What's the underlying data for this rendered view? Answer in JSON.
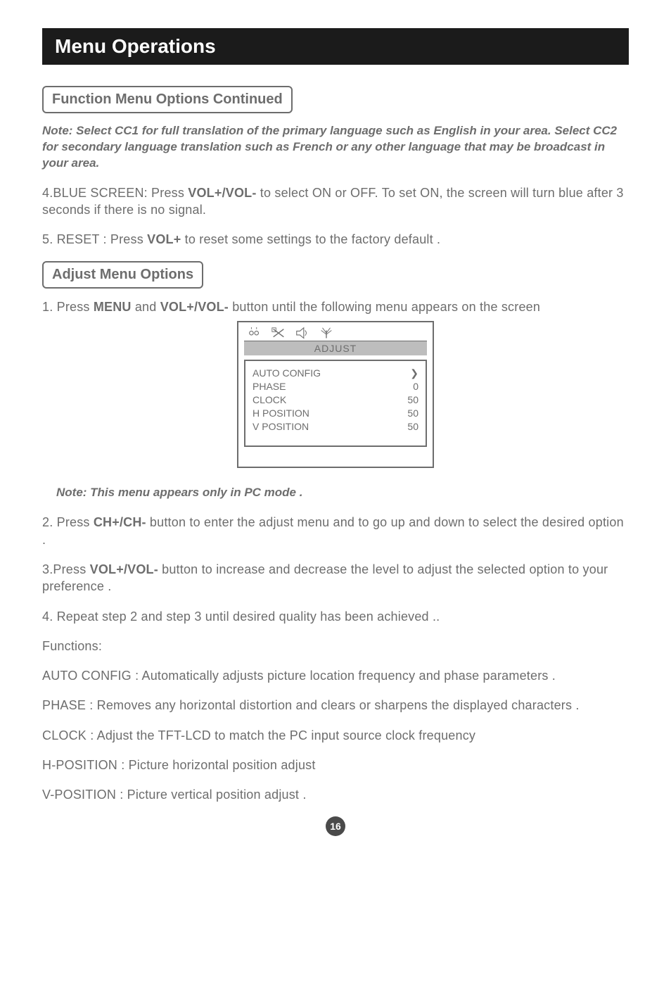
{
  "banner": "Menu Operations",
  "section1_title": "Function Menu Options Continued",
  "note1": "Note: Select CC1 for full translation of the primary language such as English in your area. Select CC2 for secondary language translation such as French  or any other language that may be broadcast in your area.",
  "p_blue_pre": "4.BLUE SCREEN: Press ",
  "p_blue_bold": "VOL+/VOL-",
  "p_blue_post": " to select ON or OFF.  To set ON, the screen will turn blue after 3 seconds if there is no signal.",
  "p_reset_pre": "5. RESET : Press ",
  "p_reset_bold": "VOL+",
  "p_reset_post": " to reset some settings to the factory default .",
  "section2_title": "Adjust  Menu Options",
  "p_step1_pre": "1. Press ",
  "p_step1_b1": "MENU",
  "p_step1_mid": " and ",
  "p_step1_b2": "VOL+/VOL-",
  "p_step1_post": " button until the following menu appears on the screen",
  "menu": {
    "title": "ADJUST",
    "rows": [
      {
        "label": "AUTO CONFIG",
        "value": "❯"
      },
      {
        "label": "PHASE",
        "value": "0"
      },
      {
        "label": "CLOCK",
        "value": "50"
      },
      {
        "label": "H POSITION",
        "value": "50"
      },
      {
        "label": "V POSITION",
        "value": "50"
      }
    ]
  },
  "note2": "Note: This menu appears only in PC mode .",
  "p_step2_pre": "2. Press ",
  "p_step2_bold": "CH+/CH-",
  "p_step2_post": " button to enter the adjust menu and to go up and down to select the desired option .",
  "p_step3_pre": "3.Press ",
  "p_step3_bold": "VOL+/VOL-",
  "p_step3_post": " button to increase and decrease the level to adjust the selected option to your preference .",
  "p_step4": "4. Repeat step 2 and step 3 until desired quality has been achieved ..",
  "functions_heading": "Functions:",
  "func_auto": "AUTO CONFIG : Automatically adjusts picture location frequency and phase parameters .",
  "func_phase": "PHASE : Removes any horizontal distortion and clears or sharpens the displayed characters .",
  "func_clock": "CLOCK : Adjust the TFT-LCD to match the PC input source clock frequency",
  "func_hpos": "H-POSITION : Picture horizontal position adjust",
  "func_vpos": "V-POSITION : Picture vertical position adjust .",
  "page_number": "16"
}
